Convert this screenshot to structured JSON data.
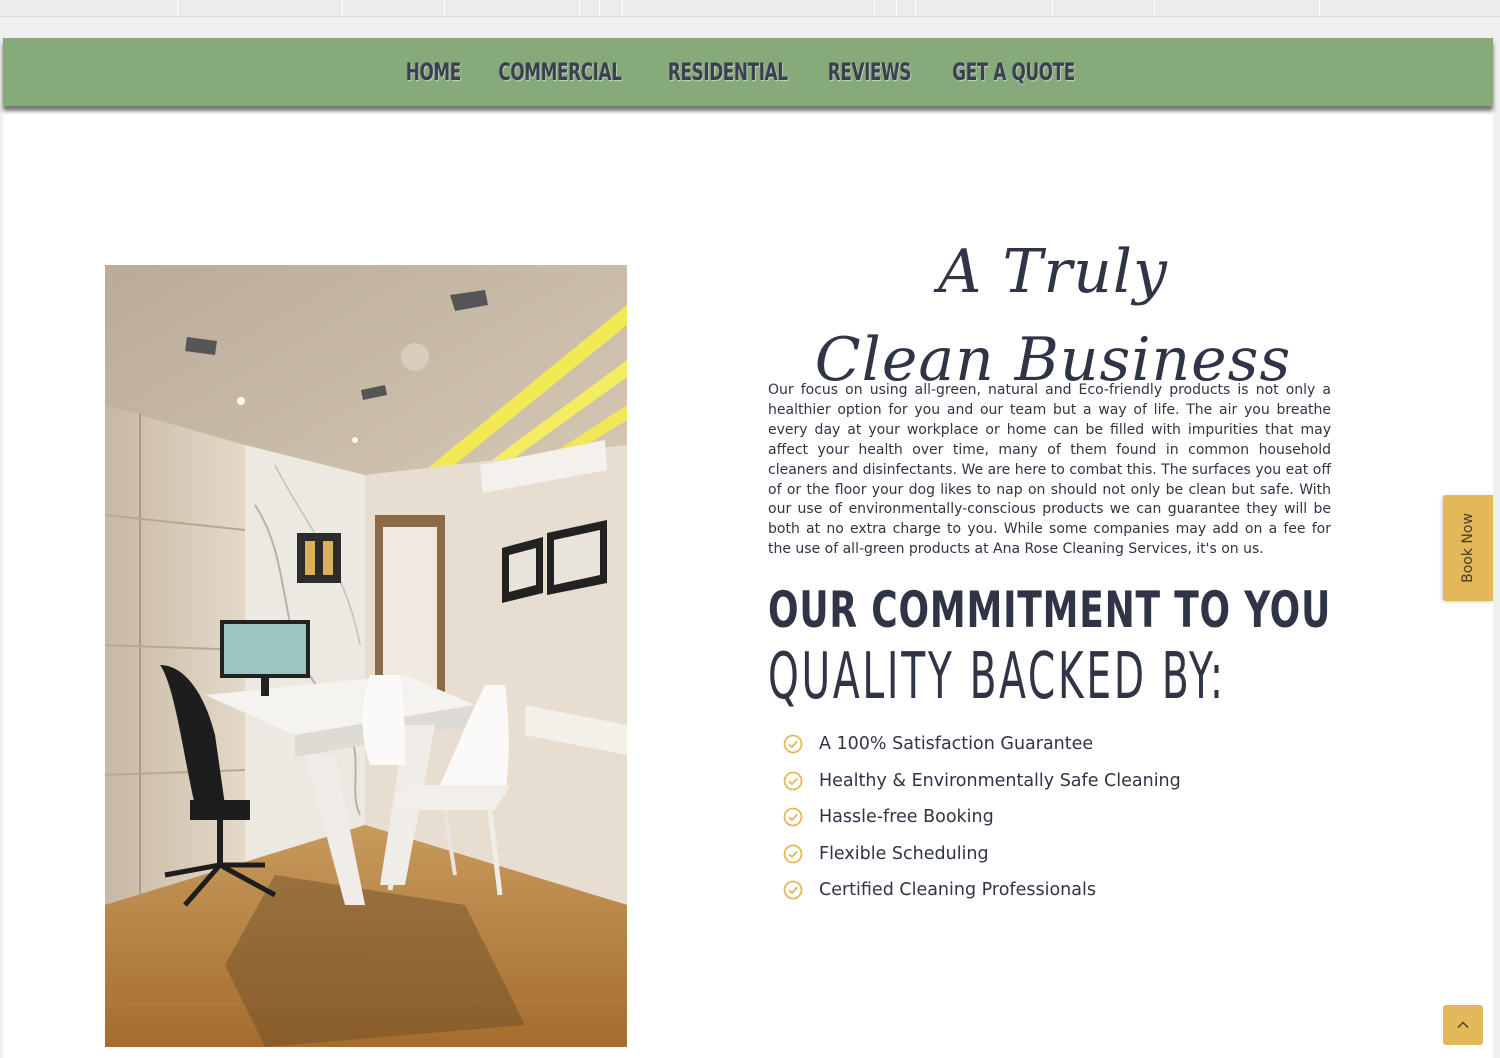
{
  "nav": {
    "items": [
      "HOME",
      "COMMERCIAL",
      "RESIDENTIAL",
      "REVIEWS",
      "GET A QUOTE"
    ]
  },
  "hero": {
    "title_line1": "A Truly",
    "title_line2": "Clean Business",
    "intro": "Our focus on using all-green, natural and Eco-friendly products is not only a healthier option for you and our team but a way of life. The air you breathe every day at your workplace or home can be filled with impurities that may affect your health over time, many of them found in common household cleaners and disinfectants. We are here to combat this. The surfaces you eat off of or the floor your dog likes to nap on should not only be clean but safe. With our use of environmentally-conscious products we can guarantee they will be both at no extra charge to you. While some companies may add on a fee for the use of all-green products at Ana Rose Cleaning Services, it's on us."
  },
  "commitment": {
    "heading": "OUR COMMITMENT TO YOU",
    "subheading": "QUALITY BACKED BY:",
    "items": [
      "A 100% Satisfaction Guarantee",
      "Healthy & Environmentally Safe Cleaning",
      "Hassle-free Booking",
      "Flexible Scheduling",
      "Certified Cleaning Professionals"
    ]
  },
  "widgets": {
    "book_now": "Book Now",
    "scroll_top_icon": "chevron-up-icon",
    "check_icon": "check-circle-icon"
  },
  "colors": {
    "nav_bg": "#86aa79",
    "text_dark": "#2f3446",
    "accent_gold": "#e2b85a"
  }
}
